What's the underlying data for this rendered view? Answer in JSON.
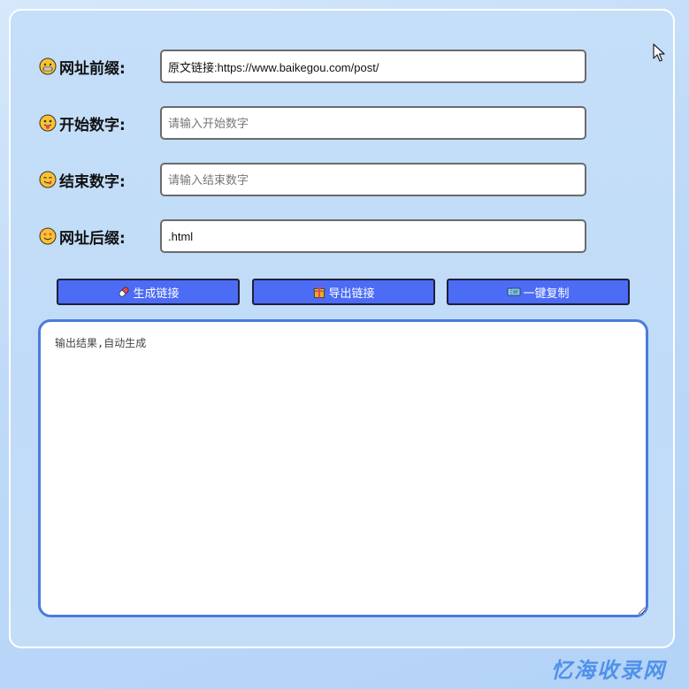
{
  "form": {
    "prefix": {
      "label": "网址前缀:",
      "value": "原文链接:https://www.baikegou.com/post/",
      "placeholder": "",
      "icon": "grinning-face-icon"
    },
    "start": {
      "label": "开始数字:",
      "value": "",
      "placeholder": "请输入开始数字",
      "icon": "tongue-face-icon"
    },
    "end": {
      "label": "结束数字:",
      "value": "",
      "placeholder": "请输入结束数字",
      "icon": "yum-face-icon"
    },
    "suffix": {
      "label": "网址后缀:",
      "value": ".html",
      "placeholder": "",
      "icon": "hearts-face-icon"
    }
  },
  "buttons": {
    "generate": {
      "label": "生成链接",
      "icon": "pill-icon"
    },
    "export": {
      "label": "导出链接",
      "icon": "gift-icon"
    },
    "copy": {
      "label": "一键复制",
      "icon": "ticket-icon"
    }
  },
  "output": {
    "placeholder": "输出结果,自动生成"
  },
  "watermark": "忆海收录网",
  "colors": {
    "button": "#4c6cf5",
    "output_border": "#4a7bdc",
    "background": "#c0dbf8"
  }
}
